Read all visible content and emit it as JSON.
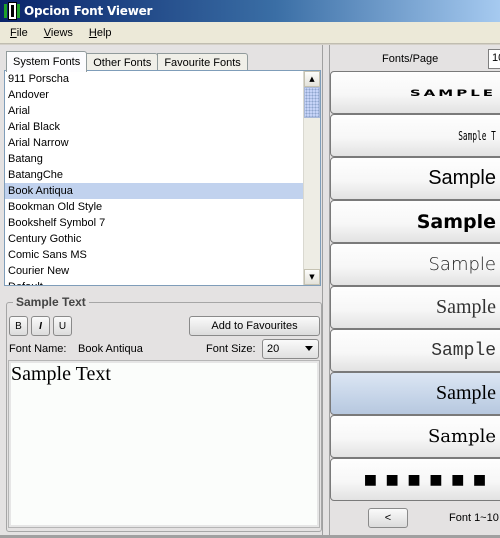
{
  "window": {
    "title": "Opcion Font Viewer",
    "icon": "app-logo-icon"
  },
  "menu": [
    {
      "label": "File",
      "accel": "F",
      "rest": "ile"
    },
    {
      "label": "Views",
      "accel": "V",
      "rest": "iews"
    },
    {
      "label": "Help",
      "accel": "H",
      "rest": "elp"
    }
  ],
  "tabs": [
    {
      "label": "System Fonts",
      "active": true
    },
    {
      "label": "Other Fonts",
      "active": false
    },
    {
      "label": "Favourite Fonts",
      "active": false
    }
  ],
  "font_list": {
    "items": [
      "911 Porscha",
      "Andover",
      "Arial",
      "Arial Black",
      "Arial Narrow",
      "Batang",
      "BatangChe",
      "Book Antiqua",
      "Bookman Old Style",
      "Bookshelf Symbol 7",
      "Century Gothic",
      "Comic Sans MS",
      "Courier New",
      "Default"
    ],
    "selected": "Book Antiqua",
    "scroll_up_icon": "triangle-up-icon",
    "scroll_down_icon": "triangle-down-icon"
  },
  "sample_group": {
    "title": "Sample Text",
    "bold_label": "B",
    "italic_label": "I",
    "underline_label": "U",
    "add_favourites_label": "Add to Favourites",
    "font_name_label": "Font Name:",
    "font_name_value": "Book Antiqua",
    "font_size_label": "Font Size:",
    "font_size_value": "20",
    "sample_text": "Sample Text"
  },
  "preview": {
    "fonts_per_page_label": "Fonts/Page",
    "fonts_per_page_value": "10",
    "items": [
      {
        "text": "SAMPLE",
        "selected": false
      },
      {
        "text": "Sample T",
        "selected": false
      },
      {
        "text": "Sample",
        "selected": false
      },
      {
        "text": "Sample",
        "selected": false
      },
      {
        "text": "Sample",
        "selected": false
      },
      {
        "text": "Sample",
        "selected": false
      },
      {
        "text": "Sample",
        "selected": false
      },
      {
        "text": "Sample",
        "selected": true
      },
      {
        "text": "Sample",
        "selected": false
      },
      {
        "text": "■■■■■■",
        "selected": false
      }
    ],
    "prev_label": "<",
    "page_status": "Font 1~10"
  }
}
